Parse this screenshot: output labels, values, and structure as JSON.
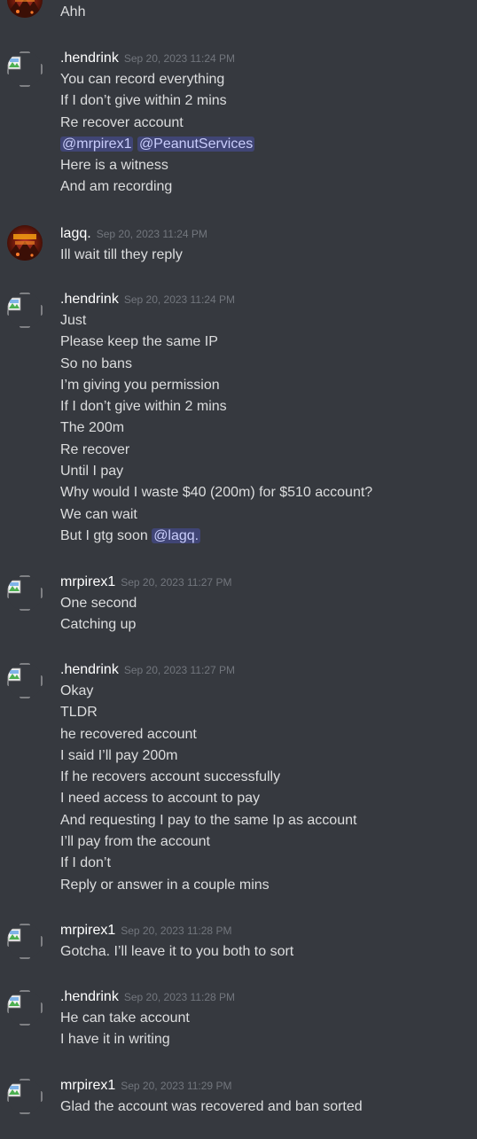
{
  "colors": {
    "background": "#36393f",
    "username": "#ffffff",
    "text": "#dcddde",
    "timestamp": "#72767d",
    "mention_bg": "#5865f2",
    "mention_text": "#c9cdfb"
  },
  "top_partial": {
    "avatar": "lava-avatar",
    "line": "Ahh"
  },
  "messages": [
    {
      "author": ".hendrink",
      "timestamp": "Sep 20, 2023 11:24 PM",
      "avatar": "broken-image-avatar",
      "lines": [
        [
          "You can record everything"
        ],
        [
          "If I don’t give within 2 mins"
        ],
        [
          "Re recover account"
        ],
        [
          "",
          "@mrpirex1",
          " ",
          "@PeanutServices"
        ],
        [
          "Here is a witness"
        ],
        [
          "And am recording"
        ]
      ]
    },
    {
      "author": "lagq.",
      "timestamp": "Sep 20, 2023 11:24 PM",
      "avatar": "lava-avatar",
      "lines": [
        [
          "Ill wait till they reply"
        ]
      ]
    },
    {
      "author": ".hendrink",
      "timestamp": "Sep 20, 2023 11:24 PM",
      "avatar": "broken-image-avatar",
      "lines": [
        [
          "Just"
        ],
        [
          "Please keep the same IP"
        ],
        [
          "So no bans"
        ],
        [
          "I’m giving you permission"
        ],
        [
          "If I don’t give within 2 mins"
        ],
        [
          "The 200m"
        ],
        [
          "Re recover"
        ],
        [
          "Until I pay"
        ],
        [
          "Why would I waste $40 (200m) for $510 account?"
        ],
        [
          "We can wait"
        ],
        [
          "But I gtg soon ",
          "@lagq."
        ]
      ]
    },
    {
      "author": "mrpirex1",
      "timestamp": "Sep 20, 2023 11:27 PM",
      "avatar": "broken-image-avatar",
      "lines": [
        [
          "One second"
        ],
        [
          "Catching up"
        ]
      ]
    },
    {
      "author": ".hendrink",
      "timestamp": "Sep 20, 2023 11:27 PM",
      "avatar": "broken-image-avatar",
      "lines": [
        [
          "Okay"
        ],
        [
          "TLDR"
        ],
        [
          "he recovered account"
        ],
        [
          "I said I’ll pay 200m"
        ],
        [
          "If he recovers account successfully"
        ],
        [
          "I need access to account to pay"
        ],
        [
          "And requesting I pay to the same Ip as account"
        ],
        [
          "I’ll pay from the account"
        ],
        [
          "If I don’t"
        ],
        [
          "Reply or answer in a couple mins"
        ]
      ]
    },
    {
      "author": "mrpirex1",
      "timestamp": "Sep 20, 2023 11:28 PM",
      "avatar": "broken-image-avatar",
      "lines": [
        [
          "Gotcha. I’ll leave it to you both to sort"
        ]
      ]
    },
    {
      "author": ".hendrink",
      "timestamp": "Sep 20, 2023 11:28 PM",
      "avatar": "broken-image-avatar",
      "lines": [
        [
          "He can take account"
        ],
        [
          "I have it in writing"
        ]
      ]
    },
    {
      "author": "mrpirex1",
      "timestamp": "Sep 20, 2023 11:29 PM",
      "avatar": "broken-image-avatar",
      "lines": [
        [
          "Glad the account was recovered and ban sorted"
        ]
      ]
    }
  ]
}
